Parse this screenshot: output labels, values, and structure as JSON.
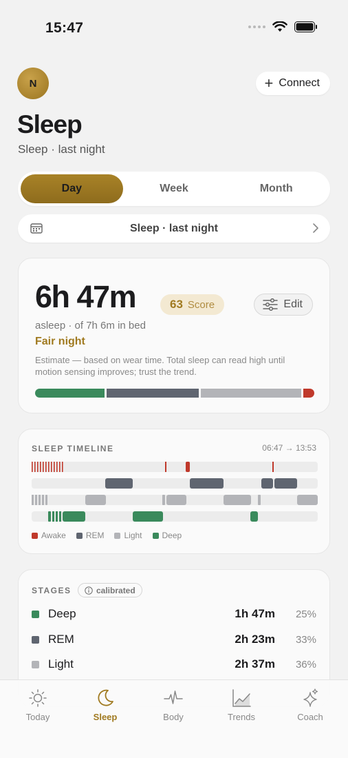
{
  "status": {
    "time": "15:47"
  },
  "header": {
    "avatar_initial": "N",
    "connect_label": "Connect",
    "title": "Sleep",
    "subtitle": "Sleep · last night"
  },
  "segmented": {
    "tabs": [
      "Day",
      "Week",
      "Month"
    ],
    "active": "Day"
  },
  "date_nav": {
    "label": "Sleep · last night"
  },
  "summary": {
    "duration": "6h 47m",
    "score_value": "63",
    "score_label": "Score",
    "edit_label": "Edit",
    "asleep_text": "asleep · of 7h 6m in bed",
    "quality": "Fair night",
    "note": "Estimate — based on wear time. Total sleep can read high until motion sensing improves; trust the trend.",
    "stage_fractions": {
      "deep": 0.25,
      "rem": 0.33,
      "light": 0.36,
      "awake": 0.04
    }
  },
  "timeline": {
    "title": "SLEEP TIMELINE",
    "range": "06:47 → 13:53",
    "legend": [
      {
        "label": "Awake",
        "color": "#c0392b"
      },
      {
        "label": "REM",
        "color": "#5f6570"
      },
      {
        "label": "Light",
        "color": "#b3b4b8"
      },
      {
        "label": "Deep",
        "color": "#3a8a5c"
      }
    ]
  },
  "stages": {
    "title": "STAGES",
    "badge": "calibrated",
    "rows": [
      {
        "name": "Deep",
        "duration": "1h 47m",
        "percent": "25%",
        "color": "#3a8a5c"
      },
      {
        "name": "REM",
        "duration": "2h 23m",
        "percent": "33%",
        "color": "#5f6570"
      },
      {
        "name": "Light",
        "duration": "2h 37m",
        "percent": "36%",
        "color": "#b3b4b8"
      }
    ]
  },
  "tabbar": {
    "items": [
      {
        "label": "Today",
        "icon": "sun-icon"
      },
      {
        "label": "Sleep",
        "icon": "moon-icon"
      },
      {
        "label": "Body",
        "icon": "pulse-icon"
      },
      {
        "label": "Trends",
        "icon": "chart-icon"
      },
      {
        "label": "Coach",
        "icon": "sparkle-icon"
      }
    ],
    "active": "Sleep"
  },
  "colors": {
    "accent": "#a07a20",
    "awake": "#c0392b",
    "rem": "#5f6570",
    "light": "#b3b4b8",
    "deep": "#3a8a5c"
  }
}
